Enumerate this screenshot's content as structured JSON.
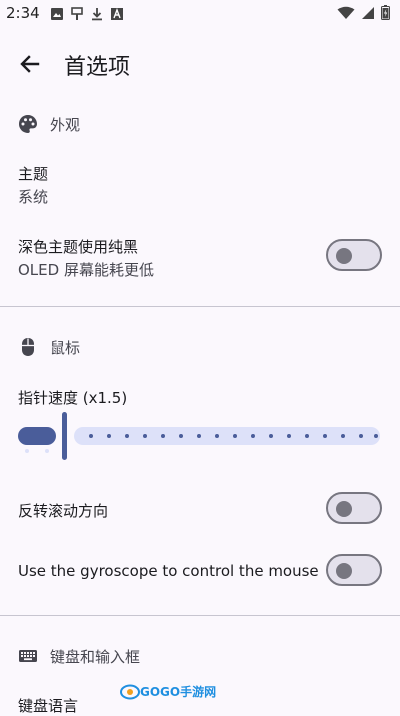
{
  "status_bar": {
    "time": "2:34",
    "left_icons": [
      "image-icon",
      "usb-icon",
      "download-icon",
      "font-icon"
    ],
    "right_icons": [
      "wifi-icon",
      "signal-icon",
      "battery-icon"
    ]
  },
  "app_bar": {
    "title": "首选项"
  },
  "sections": {
    "appearance": {
      "header": "外观",
      "theme_title": "主题",
      "theme_value": "系统",
      "dark_black_title": "深色主题使用纯黑",
      "dark_black_summary": "OLED 屏幕能耗更低",
      "dark_black_enabled": false
    },
    "mouse": {
      "header": "鼠标",
      "pointer_speed_title": "指针速度 (x1.5)",
      "pointer_speed_value": 1.5,
      "reverse_scroll_title": "反转滚动方向",
      "reverse_scroll_enabled": false,
      "gyroscope_title": "Use the gyroscope to control the mouse",
      "gyroscope_enabled": false
    },
    "keyboard": {
      "header": "键盘和输入框",
      "language_title": "键盘语言"
    }
  },
  "watermark": {
    "text": "GOGO手游网"
  },
  "colors": {
    "background": "#fbf8fd",
    "accent": "#4a5d9a",
    "track_inactive": "#dde1f9",
    "switch_off_border": "#777680"
  }
}
